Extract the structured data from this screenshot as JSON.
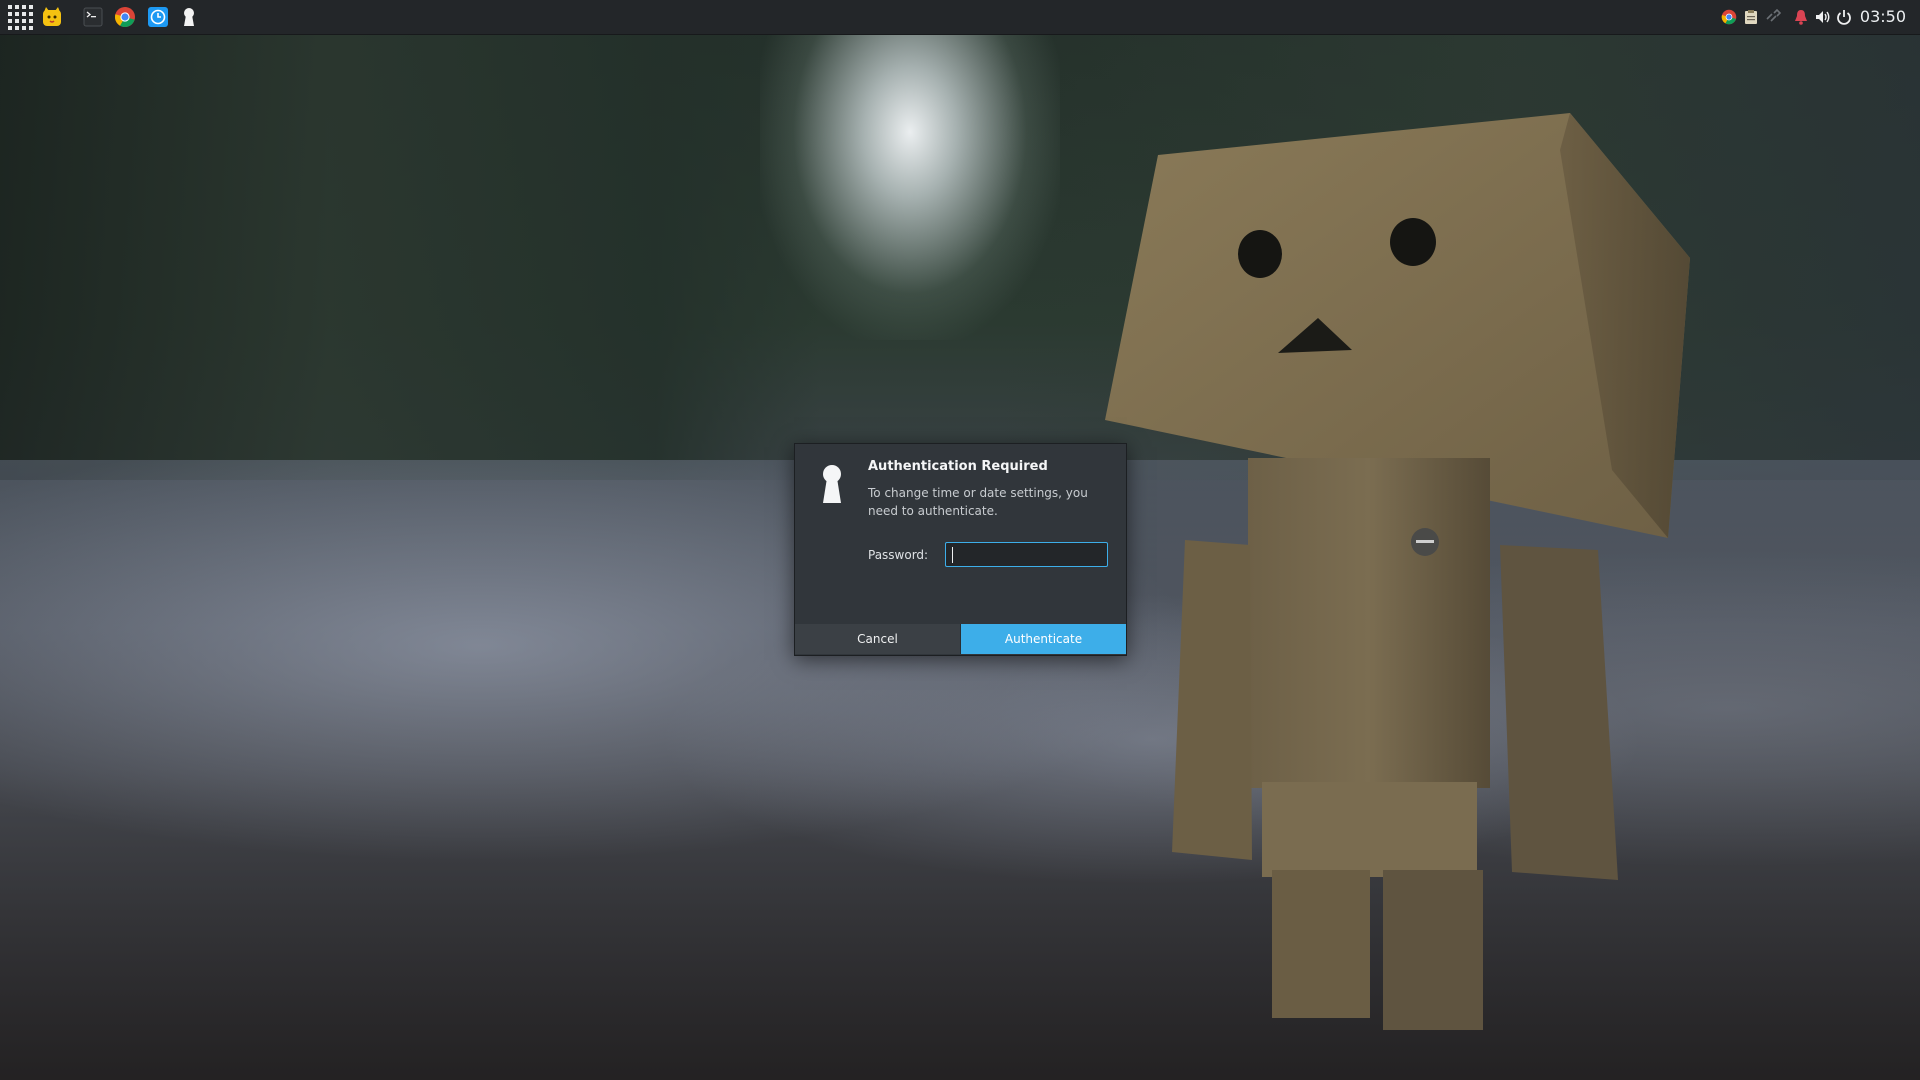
{
  "panel": {
    "launcher_icon": "app-grid-icon",
    "apps": [
      {
        "name": "cat-face-icon",
        "color": "#f5c211"
      },
      {
        "name": "terminal-icon",
        "color": "#2b2b2b"
      },
      {
        "name": "chrome-icon",
        "color": "#4285f4"
      },
      {
        "name": "clock-app-icon",
        "color": "#1d99f3"
      },
      {
        "name": "keyhole-icon",
        "color": "#ffffff"
      }
    ],
    "tray": [
      "chrome-tray-icon",
      "clipboard-icon",
      "network-icon",
      "notification-bell-icon",
      "volume-icon",
      "power-icon"
    ],
    "clock": "03:50"
  },
  "dialog": {
    "title": "Authentication Required",
    "message": "To change time or date settings, you need to authenticate.",
    "password_label": "Password:",
    "password_value": "",
    "cancel_label": "Cancel",
    "authenticate_label": "Authenticate",
    "accent_color": "#3daee9"
  }
}
